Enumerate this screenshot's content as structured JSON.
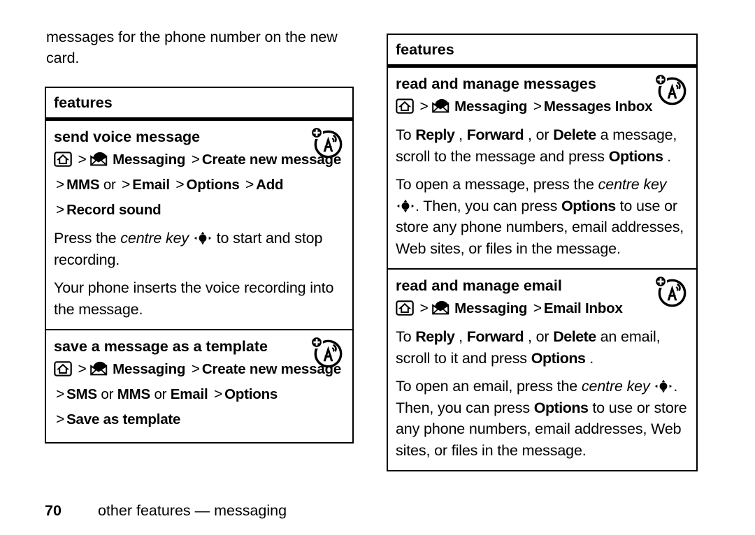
{
  "page": {
    "number": "70",
    "footer_text": "other features — messaging"
  },
  "intro": {
    "text": "messages for the phone number on the new card."
  },
  "left_column": {
    "box_title": "features",
    "sections": [
      {
        "heading": "send voice message",
        "badge_icon": "network-plus-icon",
        "path_lines": [
          {
            "parts": [
              {
                "type": "icon",
                "icon": "home-icon"
              },
              {
                "type": "gt",
                "text": ">"
              },
              {
                "type": "icon",
                "icon": "envelope-icon"
              },
              {
                "type": "bold",
                "text": "Messaging"
              },
              {
                "type": "gt",
                "text": ">"
              },
              {
                "type": "bold",
                "text": "Create new message"
              }
            ]
          },
          {
            "parts": [
              {
                "type": "gt",
                "text": ">"
              },
              {
                "type": "bold",
                "text": "MMS"
              },
              {
                "type": "lite",
                "text": "or"
              },
              {
                "type": "gt",
                "text": ">"
              },
              {
                "type": "bold",
                "text": "Email"
              },
              {
                "type": "gt",
                "text": ">"
              },
              {
                "type": "bold",
                "text": "Options"
              },
              {
                "type": "gt",
                "text": ">"
              },
              {
                "type": "bold",
                "text": "Add"
              }
            ]
          },
          {
            "parts": [
              {
                "type": "gt",
                "text": ">"
              },
              {
                "type": "bold",
                "text": "Record sound"
              }
            ]
          }
        ],
        "paragraphs": [
          {
            "parts": [
              {
                "type": "text",
                "text": "Press the "
              },
              {
                "type": "italic",
                "text": "centre key"
              },
              {
                "type": "text",
                "text": " "
              },
              {
                "type": "icon",
                "icon": "centre-key-icon"
              },
              {
                "type": "text",
                "text": " to start and stop recording."
              }
            ]
          },
          {
            "parts": [
              {
                "type": "text",
                "text": "Your phone inserts the voice recording into the message."
              }
            ]
          }
        ]
      },
      {
        "heading": "save a message as a template",
        "badge_icon": "network-plus-icon",
        "path_lines": [
          {
            "parts": [
              {
                "type": "icon",
                "icon": "home-icon"
              },
              {
                "type": "gt",
                "text": ">"
              },
              {
                "type": "icon",
                "icon": "envelope-icon"
              },
              {
                "type": "bold",
                "text": "Messaging"
              },
              {
                "type": "gt",
                "text": ">"
              },
              {
                "type": "bold",
                "text": "Create new message"
              }
            ]
          },
          {
            "parts": [
              {
                "type": "gt",
                "text": ">"
              },
              {
                "type": "bold",
                "text": "SMS"
              },
              {
                "type": "lite",
                "text": "or"
              },
              {
                "type": "bold",
                "text": "MMS"
              },
              {
                "type": "lite",
                "text": "or"
              },
              {
                "type": "bold",
                "text": "Email"
              },
              {
                "type": "gt",
                "text": ">"
              },
              {
                "type": "bold",
                "text": "Options"
              }
            ]
          },
          {
            "parts": [
              {
                "type": "gt",
                "text": ">"
              },
              {
                "type": "bold",
                "text": "Save as template"
              }
            ]
          }
        ],
        "paragraphs": []
      }
    ]
  },
  "right_column": {
    "box_title": "features",
    "sections": [
      {
        "heading": "read and manage messages",
        "badge_icon": "network-plus-icon",
        "path_lines": [
          {
            "parts": [
              {
                "type": "icon",
                "icon": "home-icon"
              },
              {
                "type": "gt",
                "text": ">"
              },
              {
                "type": "icon",
                "icon": "envelope-icon"
              },
              {
                "type": "bold",
                "text": "Messaging"
              },
              {
                "type": "gt",
                "text": ">"
              },
              {
                "type": "bold",
                "text": "Messages Inbox"
              }
            ]
          }
        ],
        "paragraphs": [
          {
            "parts": [
              {
                "type": "text",
                "text": "To "
              },
              {
                "type": "bold",
                "text": "Reply"
              },
              {
                "type": "text",
                "text": ", "
              },
              {
                "type": "bold",
                "text": "Forward"
              },
              {
                "type": "text",
                "text": ", or "
              },
              {
                "type": "bold",
                "text": "Delete"
              },
              {
                "type": "text",
                "text": " a message, scroll to the message and press "
              },
              {
                "type": "bold",
                "text": "Options"
              },
              {
                "type": "text",
                "text": "."
              }
            ]
          },
          {
            "parts": [
              {
                "type": "text",
                "text": "To open a message, press the "
              },
              {
                "type": "italic",
                "text": "centre key"
              },
              {
                "type": "text",
                "text": " "
              },
              {
                "type": "icon",
                "icon": "centre-key-icon"
              },
              {
                "type": "text",
                "text": ". Then, you can press "
              },
              {
                "type": "bold",
                "text": "Options"
              },
              {
                "type": "text",
                "text": " to use or store any phone numbers, email addresses, Web sites, or files in the message."
              }
            ]
          }
        ]
      },
      {
        "heading": "read and manage email",
        "badge_icon": "network-plus-icon",
        "path_lines": [
          {
            "parts": [
              {
                "type": "icon",
                "icon": "home-icon"
              },
              {
                "type": "gt",
                "text": ">"
              },
              {
                "type": "icon",
                "icon": "envelope-icon"
              },
              {
                "type": "bold",
                "text": "Messaging"
              },
              {
                "type": "gt",
                "text": ">"
              },
              {
                "type": "bold",
                "text": "Email Inbox"
              }
            ]
          }
        ],
        "paragraphs": [
          {
            "parts": [
              {
                "type": "text",
                "text": "To "
              },
              {
                "type": "bold",
                "text": "Reply"
              },
              {
                "type": "text",
                "text": ", "
              },
              {
                "type": "bold",
                "text": "Forward"
              },
              {
                "type": "text",
                "text": ", or "
              },
              {
                "type": "bold",
                "text": "Delete"
              },
              {
                "type": "text",
                "text": " an email, scroll to it and press "
              },
              {
                "type": "bold",
                "text": "Options"
              },
              {
                "type": "text",
                "text": "."
              }
            ]
          },
          {
            "parts": [
              {
                "type": "text",
                "text": "To open an email, press the "
              },
              {
                "type": "italic",
                "text": "centre key"
              },
              {
                "type": "text",
                "text": " "
              },
              {
                "type": "icon",
                "icon": "centre-key-icon"
              },
              {
                "type": "text",
                "text": ". Then, you can press "
              },
              {
                "type": "bold",
                "text": "Options"
              },
              {
                "type": "text",
                "text": " to use or store any phone numbers, email addresses, Web sites, or files in the message."
              }
            ]
          }
        ]
      }
    ]
  },
  "colors": {
    "ink": "#000000",
    "paper": "#ffffff"
  }
}
